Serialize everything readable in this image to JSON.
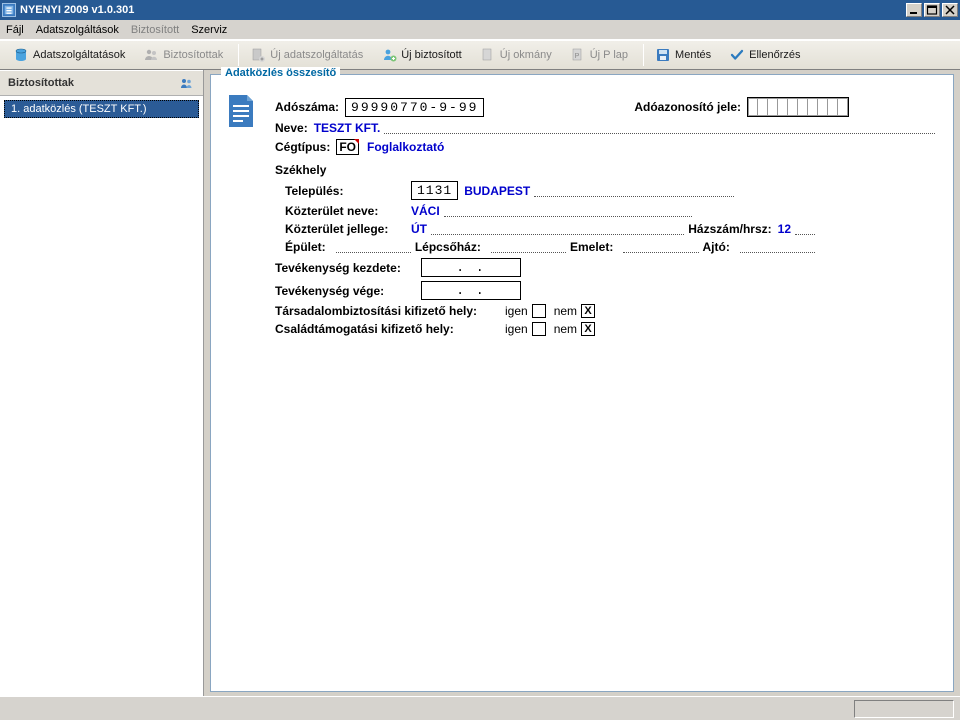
{
  "window": {
    "title": "NYENYI 2009  v1.0.301"
  },
  "menu": {
    "file": "Fájl",
    "adatszolg": "Adatszolgáltások",
    "biztositott": "Biztosított",
    "szerviz": "Szerviz"
  },
  "toolbar": {
    "adatszolgaltatasok": "Adatszolgáltatások",
    "biztositottak": "Biztosítottak",
    "uj_adatszolgaltatas": "Új adatszolgáltatás",
    "uj_biztositott": "Új biztosított",
    "uj_okmany": "Új okmány",
    "uj_plap": "Új P lap",
    "mentes": "Mentés",
    "ellenorzes": "Ellenőrzés"
  },
  "sidebar": {
    "header": "Biztosítottak",
    "items": [
      "1. adatközlés (TESZT KFT.)"
    ]
  },
  "panel": {
    "title": "Adatközlés összesítő",
    "adoszama_label": "Adószáma:",
    "adoszama_value": "99990770-9-99",
    "adoazonosito_label": "Adóazonosító jele:",
    "neve_label": "Neve:",
    "neve_value": "TESZT KFT.",
    "cegtipus_label": "Cégtípus:",
    "cegtipus_code": "FO",
    "cegtipus_value": "Foglalkoztató",
    "szekhely_label": "Székhely",
    "telepules_label": "Település:",
    "telepules_irsz": "1131",
    "telepules_value": "BUDAPEST",
    "kozterulet_neve_label": "Közterület neve:",
    "kozterulet_neve_value": "VÁCI",
    "kozterulet_jellege_label": "Közterület jellege:",
    "kozterulet_jellege_value": "ÚT",
    "hazszam_label": "Házszám/hrsz:",
    "hazszam_value": "12",
    "epulet_label": "Épület:",
    "lepcsohaz_label": "Lépcsőház:",
    "emelet_label": "Emelet:",
    "ajto_label": "Ajtó:",
    "kezdet_label": "Tevékenység kezdete:",
    "vege_label": "Tevékenység vége:",
    "tb_label": "Társadalombiztosítási kifizető hely:",
    "csalad_label": "Családtámogatási kifizető hely:",
    "igen": "igen",
    "nem": "nem",
    "x": "X",
    "date_placeholder": "     .   .   "
  }
}
